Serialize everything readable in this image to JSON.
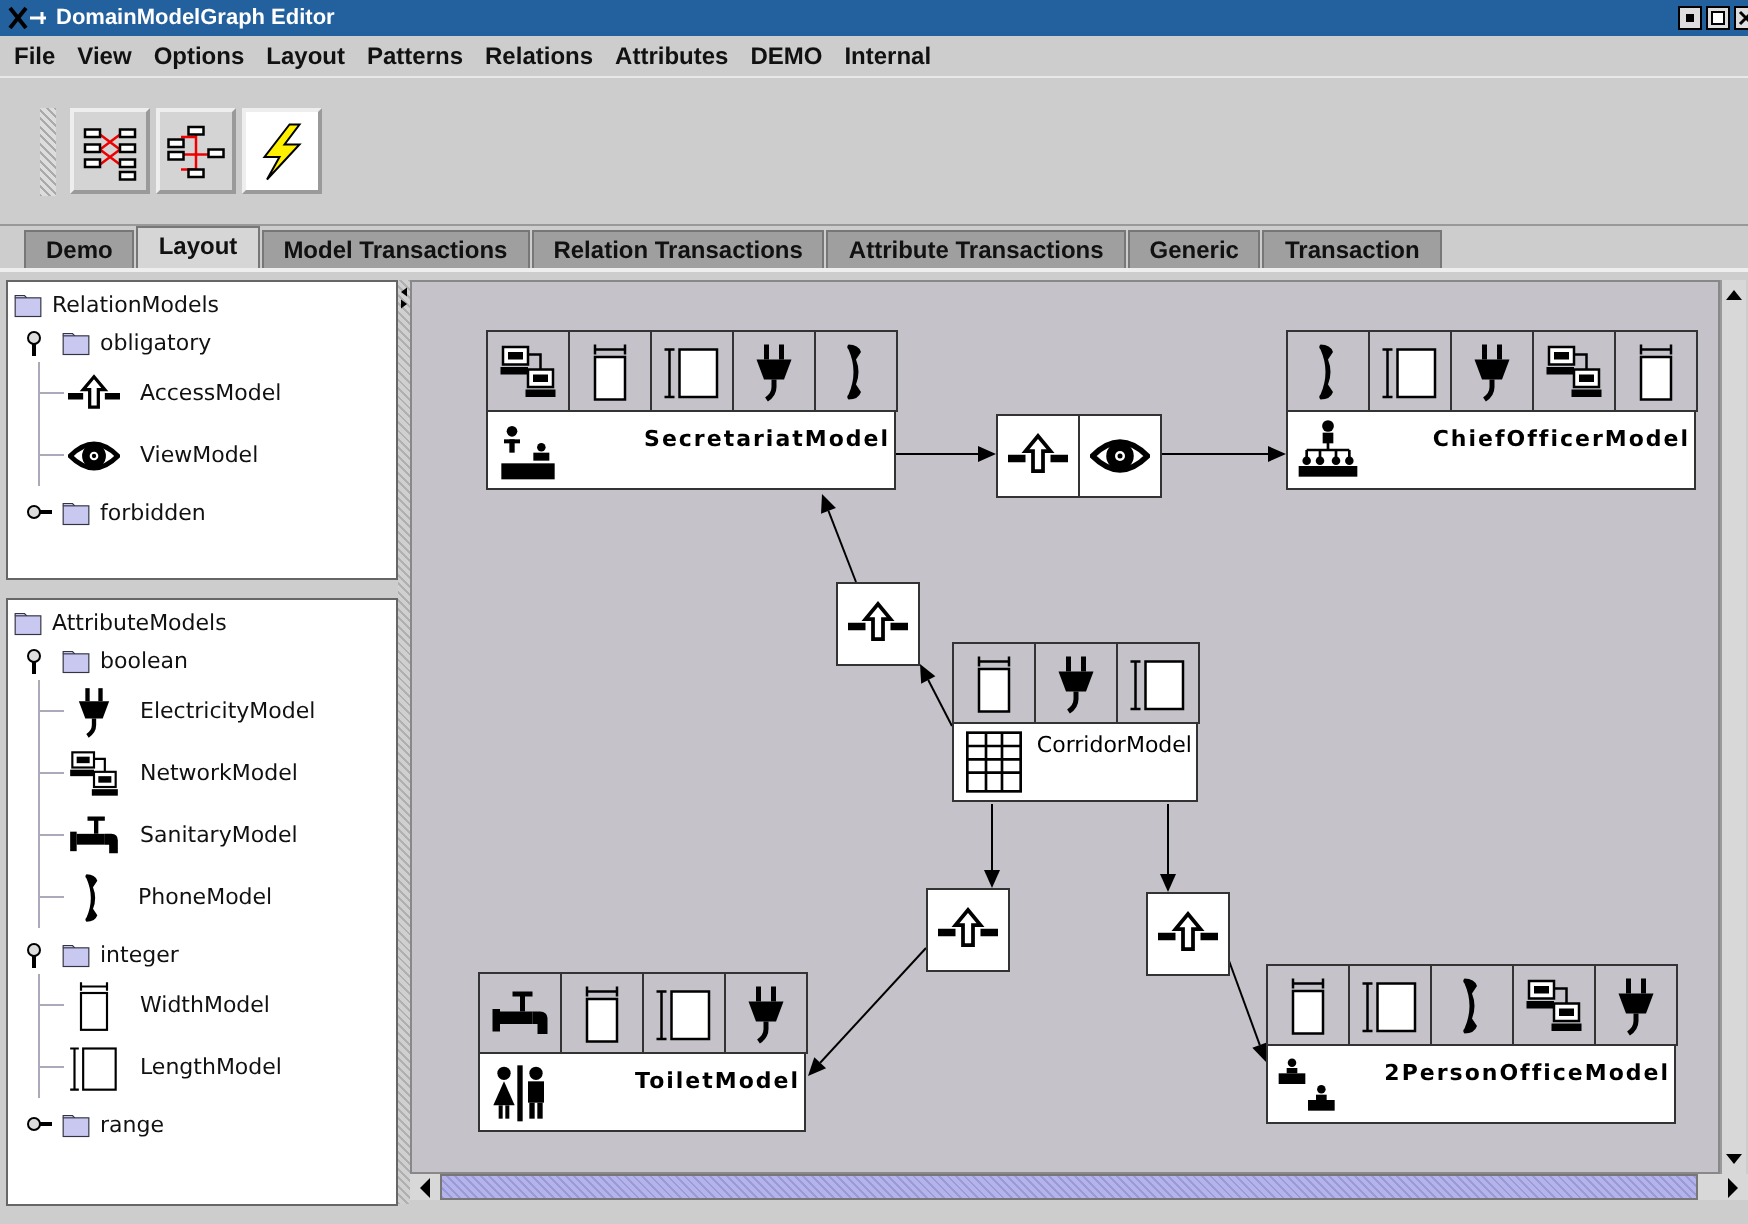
{
  "window": {
    "title": "DomainModelGraph Editor"
  },
  "menu": [
    "File",
    "View",
    "Options",
    "Layout",
    "Patterns",
    "Relations",
    "Attributes",
    "DEMO",
    "Internal"
  ],
  "toolbar": [
    {
      "kind": "layout-a"
    },
    {
      "kind": "layout-b"
    },
    {
      "kind": "lightning"
    }
  ],
  "tabs": [
    {
      "label": "Demo",
      "selected": false
    },
    {
      "label": "Layout",
      "selected": true
    },
    {
      "label": "Model Transactions",
      "selected": false
    },
    {
      "label": "Relation Transactions",
      "selected": false
    },
    {
      "label": "Attribute Transactions",
      "selected": false
    },
    {
      "label": "Generic",
      "selected": false
    },
    {
      "label": "Transaction",
      "selected": false
    }
  ],
  "relation_tree": {
    "label": "RelationModels",
    "folders": [
      {
        "label": "obligatory",
        "expanded": true,
        "children": [
          {
            "label": "AccessModel",
            "kind": "access"
          },
          {
            "label": "ViewModel",
            "kind": "view"
          }
        ]
      },
      {
        "label": "forbidden",
        "expanded": false
      }
    ]
  },
  "attribute_tree": {
    "label": "AttributeModels",
    "folders": [
      {
        "label": "boolean",
        "expanded": true,
        "children": [
          {
            "label": "ElectricityModel",
            "kind": "plug"
          },
          {
            "label": "NetworkModel",
            "kind": "network"
          },
          {
            "label": "SanitaryModel",
            "kind": "sanitary"
          },
          {
            "label": "PhoneModel",
            "kind": "phone"
          }
        ]
      },
      {
        "label": "integer",
        "expanded": true,
        "children": [
          {
            "label": "WidthModel",
            "kind": "width"
          },
          {
            "label": "LengthModel",
            "kind": "length"
          }
        ]
      },
      {
        "label": "range",
        "expanded": false
      }
    ]
  },
  "graph": {
    "entities": [
      {
        "name": "SecretariatModel",
        "kind": "secretariat",
        "attributes": [
          {
            "kind": "network"
          },
          {
            "kind": "width"
          },
          {
            "kind": "length"
          },
          {
            "kind": "plug"
          },
          {
            "kind": "phone"
          }
        ]
      },
      {
        "name": "ChiefOfficerModel",
        "kind": "chief",
        "attributes": [
          {
            "kind": "phone"
          },
          {
            "kind": "length"
          },
          {
            "kind": "plug"
          },
          {
            "kind": "network"
          },
          {
            "kind": "width"
          }
        ]
      },
      {
        "name": "CorridorModel",
        "kind": "corridor",
        "attributes": [
          {
            "kind": "width"
          },
          {
            "kind": "plug"
          },
          {
            "kind": "length"
          }
        ]
      },
      {
        "name": "ToiletModel",
        "kind": "toilet",
        "attributes": [
          {
            "kind": "sanitary"
          },
          {
            "kind": "width"
          },
          {
            "kind": "length"
          },
          {
            "kind": "plug"
          }
        ]
      },
      {
        "name": "2PersonOfficeModel",
        "kind": "office2",
        "attributes": [
          {
            "kind": "width"
          },
          {
            "kind": "length"
          },
          {
            "kind": "phone"
          },
          {
            "kind": "network"
          },
          {
            "kind": "plug"
          }
        ]
      }
    ],
    "relations": [
      {
        "kinds": [
          {
            "kind": "access"
          },
          {
            "kind": "view"
          }
        ]
      },
      {
        "kinds": [
          {
            "kind": "access"
          }
        ]
      },
      {
        "kinds": [
          {
            "kind": "access"
          }
        ]
      },
      {
        "kinds": [
          {
            "kind": "access"
          }
        ]
      }
    ]
  }
}
